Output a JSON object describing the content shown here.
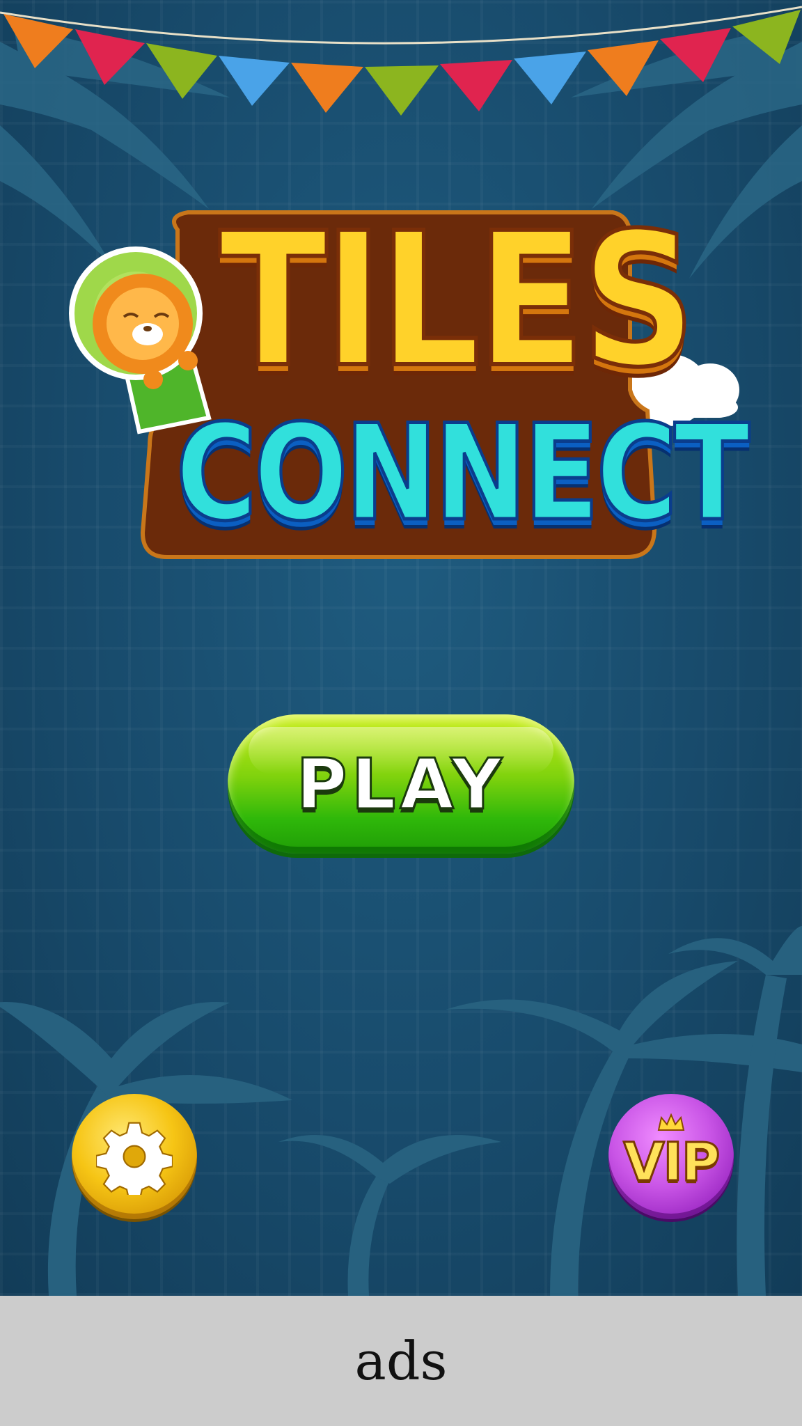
{
  "title": {
    "line1": "TILES",
    "line2": "CONNECT"
  },
  "play_button": {
    "label": "PLAY"
  },
  "settings_button": {
    "icon": "gear-icon"
  },
  "vip_button": {
    "label": "VIP",
    "icon": "crown-icon"
  },
  "ads": {
    "label": "ads"
  },
  "colors": {
    "background": "#1a4a6c",
    "title_yellow": "#ffd22a",
    "title_cyan": "#31e0dc",
    "play_green": "#4cc40c",
    "settings_gold": "#f6c515",
    "vip_purple": "#c955e6",
    "ads_gray": "#cccccc"
  },
  "decorations": {
    "bunting_flag_colors": [
      "#ef7d1e",
      "#e0244f",
      "#8cb51f",
      "#4aa3e8",
      "#ef7d1e",
      "#8cb51f",
      "#e0244f",
      "#4aa3e8",
      "#ef7d1e",
      "#e0244f",
      "#8cb51f"
    ],
    "mascot": "lion-in-balloon"
  }
}
